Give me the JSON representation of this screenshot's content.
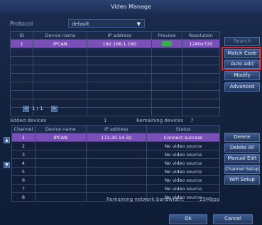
{
  "window": {
    "title": "Video Manage"
  },
  "protocol": {
    "label": "Protocol",
    "value": "default",
    "arrow": "▼"
  },
  "search_table": {
    "headers": [
      "ID",
      "Device name",
      "IP address",
      "Preview",
      "Resolution"
    ],
    "rows": [
      {
        "id": "1",
        "name": "IPCAN",
        "ip": "192.168.1.160",
        "preview": "ok",
        "resolution": "1280x720"
      }
    ]
  },
  "right_buttons_top": {
    "search": "Search",
    "match_code": "Match Code",
    "auto_add": "Auto Add",
    "modify": "Modify",
    "advanced": "Advanced"
  },
  "pager": {
    "prev": "<",
    "page": "1 / 1",
    "next": ">"
  },
  "added": {
    "added_label": "Added devices",
    "added_count": "1",
    "remaining_label": "Remaining devices",
    "remaining_count": "7"
  },
  "channel_table": {
    "headers": [
      "Channel",
      "Device name",
      "IP address",
      "Status"
    ],
    "rows": [
      {
        "ch": "1",
        "name": "IPCAN",
        "ip": "172.20.14.32",
        "status": "Connect success"
      },
      {
        "ch": "2",
        "name": "",
        "ip": "",
        "status": "No video source"
      },
      {
        "ch": "3",
        "name": "",
        "ip": "",
        "status": "No video source"
      },
      {
        "ch": "4",
        "name": "",
        "ip": "",
        "status": "No video source"
      },
      {
        "ch": "5",
        "name": "",
        "ip": "",
        "status": "No video source"
      },
      {
        "ch": "6",
        "name": "",
        "ip": "",
        "status": "No video source"
      },
      {
        "ch": "7",
        "name": "",
        "ip": "",
        "status": "No video source"
      },
      {
        "ch": "8",
        "name": "",
        "ip": "",
        "status": "No video source"
      }
    ]
  },
  "right_buttons_bottom": {
    "delete": "Delete",
    "delete_all": "Delete All",
    "manual_edit": "Manual Edit",
    "channel_setup": "Channel Setup",
    "wifi_setup": "Wifi Setup"
  },
  "side_buttons": {
    "up": "▲",
    "down": "▼"
  },
  "bandwidth": {
    "label": "Remaining network bandwidth:",
    "value": "25Mbps"
  },
  "footer": {
    "ok": "Ok",
    "cancel": "Cancel"
  },
  "colors": {
    "selected_row": "#7b4fb8",
    "highlight": "#d92a2a",
    "preview_ok": "#35b34a"
  }
}
